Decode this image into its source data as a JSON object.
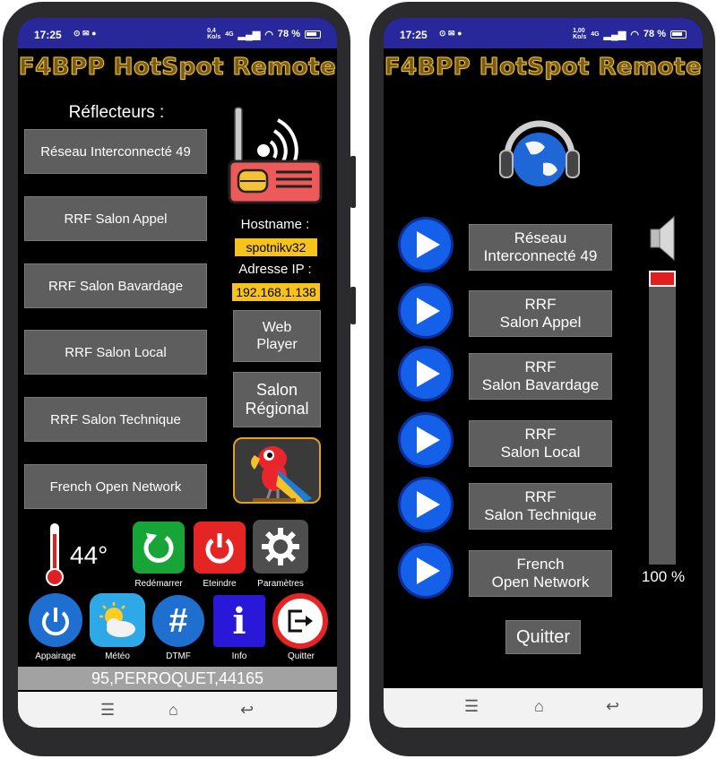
{
  "left": {
    "status": {
      "time": "17:25",
      "net_speed": "0,4\nKo/s",
      "net_type": "4G",
      "battery": "78 %"
    },
    "title": "F4BPP HotSpot Remote",
    "reflectors_heading": "Réflecteurs :",
    "reflectors": [
      "Réseau Interconnecté 49",
      "RRF Salon Appel",
      "RRF Salon Bavardage",
      "RRF Salon Local",
      "RRF Salon Technique",
      "French Open Network"
    ],
    "hostname_label": "Hostname :",
    "hostname_value": "spotnikv32",
    "ip_label": "Adresse IP :",
    "ip_value": "192.168.1.138",
    "web_player": "Web\nPlayer",
    "salon_regional": "Salon\nRégional",
    "temperature": "44°",
    "actions": {
      "restart": "Redémarrer",
      "shutdown": "Eteindre",
      "settings": "Paramètres"
    },
    "tools": {
      "pairing": "Appairage",
      "weather": "Météo",
      "dtmf": "DTMF",
      "info": "Info",
      "quit": "Quitter"
    },
    "footer": "95,PERROQUET,44165",
    "colors": {
      "status_bar": "#28289a",
      "button_grey": "#5e5e5e",
      "highlight_yellow": "#f6c21c"
    }
  },
  "right": {
    "status": {
      "time": "17:25",
      "net_speed": "1,00\nKo/s",
      "net_type": "4G",
      "battery": "78 %"
    },
    "title": "F4BPP HotSpot Remote",
    "stations": [
      "Réseau\nInterconnecté 49",
      "RRF\nSalon Appel",
      "RRF\nSalon Bavardage",
      "RRF\nSalon Local",
      "RRF\nSalon Technique",
      "French\nOpen Network"
    ],
    "volume_percent": "100 %",
    "volume_level": 1.0,
    "quit": "Quitter",
    "colors": {
      "play_blue": "#1560e8",
      "volume_red": "#e02020"
    }
  }
}
